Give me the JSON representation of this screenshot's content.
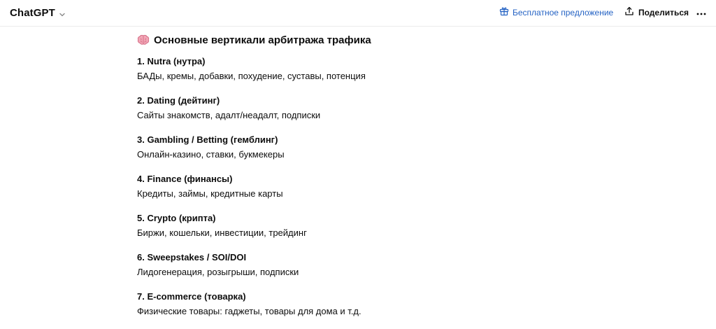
{
  "header": {
    "model_name": "ChatGPT",
    "offer_label": "Бесплатное предложение",
    "share_label": "Поделиться",
    "colors": {
      "offer": "#2563c4",
      "text": "#0d0d0d",
      "border": "#ececec"
    },
    "icons": [
      "chevron-down-icon",
      "gift-icon",
      "share-icon",
      "more-icon"
    ]
  },
  "message": {
    "heading_icon": "brain-icon",
    "heading": "Основные вертикали арбитража трафика",
    "items": [
      {
        "title": "1. Nutra (нутра)",
        "desc": "БАДы, кремы, добавки, похудение, суставы, потенция"
      },
      {
        "title": "2. Dating (дейтинг)",
        "desc": "Сайты знакомств, адалт/неадалт, подписки"
      },
      {
        "title": "3. Gambling / Betting (гемблинг)",
        "desc": "Онлайн-казино, ставки, букмекеры"
      },
      {
        "title": "4. Finance (финансы)",
        "desc": "Кредиты, займы, кредитные карты"
      },
      {
        "title": "5. Crypto (крипта)",
        "desc": "Биржи, кошельки, инвестиции, трейдинг"
      },
      {
        "title": "6. Sweepstakes / SOI/DOI",
        "desc": "Лидогенерация, розыгрыши, подписки"
      },
      {
        "title": "7. E-commerce (товарка)",
        "desc": "Физические товары: гаджеты, товары для дома и т.д."
      }
    ]
  }
}
